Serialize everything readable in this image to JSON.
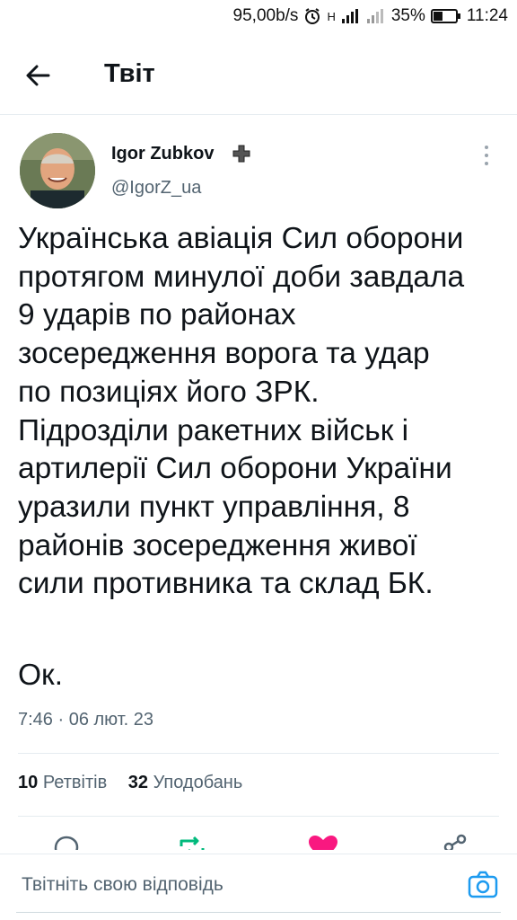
{
  "status_bar": {
    "speed": "95,00b/s",
    "network": "H",
    "battery": "35%",
    "time": "11:24"
  },
  "header": {
    "title": "Твіт"
  },
  "tweet": {
    "author_name": "Igor Zubkov",
    "author_handle": "@IgorZ_ua",
    "text": "Українська авіація Сил оборони\nпротягом минулої доби завдала\n9 ударів по районах\nзосередження ворога та удар\nпо позиціях його ЗРК.\nПідрозділи ракетних військ і\nартилерії Сил оборони України\nуразили пункт управління, 8\nрайонів зосередження живої\nсили противника та склад БК.",
    "sign_off": "Ок.",
    "timestamp": "7:46 · 06 лют. 23"
  },
  "stats": {
    "retweets_count": "10",
    "retweets_label": "Ретвітів",
    "likes_count": "32",
    "likes_label": "Уподобань"
  },
  "reply": {
    "placeholder": "Твітніть свою відповідь"
  },
  "colors": {
    "text": "#0f1419",
    "secondary": "#536471",
    "accent_blue": "#1d9bf0",
    "retweet_green": "#00ba7c",
    "like_pink": "#f91880"
  },
  "icons": {
    "back": "arrow-left-icon",
    "verified": "cross-badge-icon",
    "more": "more-vertical-icon",
    "reply": "reply-icon",
    "retweet": "retweet-icon",
    "like": "heart-icon",
    "share": "share-icon",
    "camera": "camera-icon"
  }
}
